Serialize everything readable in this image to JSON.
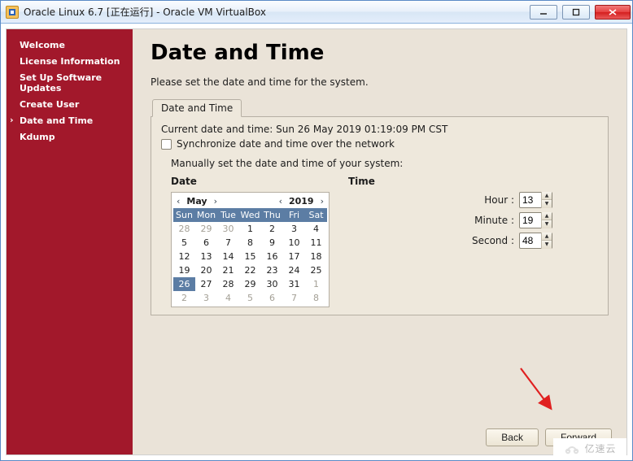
{
  "window": {
    "title": "Oracle Linux 6.7 [正在运行] - Oracle VM VirtualBox"
  },
  "sidebar": {
    "items": [
      {
        "label": "Welcome"
      },
      {
        "label": "License Information"
      },
      {
        "label": "Set Up Software Updates"
      },
      {
        "label": "Create User"
      },
      {
        "label": "Date and Time",
        "selected": true
      },
      {
        "label": "Kdump"
      }
    ]
  },
  "main": {
    "title": "Date and Time",
    "subtitle": "Please set the date and time for the system.",
    "tab_label": "Date and Time",
    "status_label": "Current date and time",
    "status_value": "Sun 26 May 2019 01:19:09 PM CST",
    "sync_label": "Synchronize date and time over the network",
    "sync_checked": false,
    "manual_label": "Manually set the date and time of your system:"
  },
  "date": {
    "heading": "Date",
    "month": "May",
    "year": "2019",
    "dow": [
      "Sun",
      "Mon",
      "Tue",
      "Wed",
      "Thu",
      "Fri",
      "Sat"
    ],
    "weeks": [
      [
        {
          "d": 28,
          "o": true
        },
        {
          "d": 29,
          "o": true
        },
        {
          "d": 30,
          "o": true
        },
        {
          "d": 1
        },
        {
          "d": 2
        },
        {
          "d": 3
        },
        {
          "d": 4
        }
      ],
      [
        {
          "d": 5
        },
        {
          "d": 6
        },
        {
          "d": 7
        },
        {
          "d": 8
        },
        {
          "d": 9
        },
        {
          "d": 10
        },
        {
          "d": 11
        }
      ],
      [
        {
          "d": 12
        },
        {
          "d": 13
        },
        {
          "d": 14
        },
        {
          "d": 15
        },
        {
          "d": 16
        },
        {
          "d": 17
        },
        {
          "d": 18
        }
      ],
      [
        {
          "d": 19
        },
        {
          "d": 20
        },
        {
          "d": 21
        },
        {
          "d": 22
        },
        {
          "d": 23
        },
        {
          "d": 24
        },
        {
          "d": 25
        }
      ],
      [
        {
          "d": 26,
          "sel": true
        },
        {
          "d": 27
        },
        {
          "d": 28
        },
        {
          "d": 29
        },
        {
          "d": 30
        },
        {
          "d": 31
        },
        {
          "d": 1,
          "o": true
        }
      ],
      [
        {
          "d": 2,
          "o": true
        },
        {
          "d": 3,
          "o": true
        },
        {
          "d": 4,
          "o": true
        },
        {
          "d": 5,
          "o": true
        },
        {
          "d": 6,
          "o": true
        },
        {
          "d": 7,
          "o": true
        },
        {
          "d": 8,
          "o": true
        }
      ]
    ]
  },
  "time": {
    "heading": "Time",
    "hour_label": "Hour",
    "minute_label": "Minute",
    "second_label": "Second",
    "hour": "13",
    "minute": "19",
    "second": "48"
  },
  "footer": {
    "back": "Back",
    "forward": "Forward"
  },
  "watermark": "亿速云"
}
